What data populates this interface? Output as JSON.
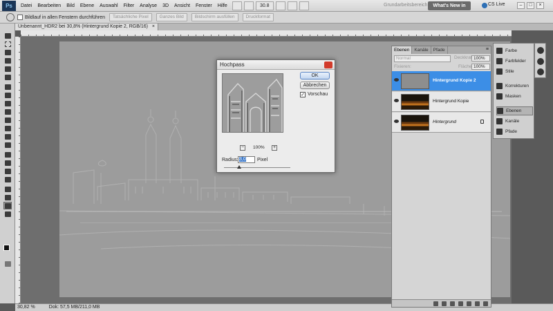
{
  "app": {
    "logo": "Ps"
  },
  "menu": {
    "items": [
      "Datei",
      "Bearbeiten",
      "Bild",
      "Ebene",
      "Auswahl",
      "Filter",
      "Analyse",
      "3D",
      "Ansicht",
      "Fenster",
      "Hilfe"
    ]
  },
  "topbar": {
    "workspace_label": "Grundarbeitsbereich",
    "whats_new": "What's New in CS5",
    "cs_live": "CS Live",
    "zoom_value": "30.8",
    "window_controls": [
      "–",
      "□",
      "×"
    ]
  },
  "options": {
    "resize_windows_label": "Bildlauf in allen Fenstern durchführen",
    "buttons": [
      "Tatsächliche Pixel",
      "Ganzes Bild",
      "Bildschirm ausfüllen",
      "Druckformat"
    ]
  },
  "document": {
    "tab_title": "Unbenannt_HDR2 bei 30,8% (Hintergrund Kopie 2, RGB/16)",
    "close_glyph": "×",
    "status_zoom": "30,82 %",
    "status_doc": "Dok: 57,5 MB/211,0 MB"
  },
  "dialog": {
    "title": "Hochpass",
    "ok_label": "OK",
    "cancel_label": "Abbrechen",
    "preview_label": "Vorschau",
    "preview_checked": true,
    "zoom_minus": "−",
    "zoom_plus": "+",
    "zoom_percent": "100%",
    "radius_label": "Radius:",
    "radius_value": "3,0",
    "radius_unit": "Pixel"
  },
  "layers_panel": {
    "tabs": [
      "Ebenen",
      "Kanäle",
      "Pfade"
    ],
    "menu_glyph": "≡",
    "blend_mode": "Normal",
    "opacity_label": "Deckkraft:",
    "opacity_value": "100%",
    "lock_label": "Fixieren:",
    "fill_label": "Fläche:",
    "fill_value": "100%",
    "layers": [
      {
        "name": "Hintergrund Kopie 2",
        "selected": true,
        "thumb": "gray"
      },
      {
        "name": "Hintergrund Kopie",
        "selected": false,
        "thumb": "night"
      },
      {
        "name": "Hintergrund",
        "selected": false,
        "thumb": "night",
        "locked": true
      }
    ]
  },
  "dock": {
    "items": [
      "Farbe",
      "Farbfelder",
      "Stile",
      "Korrekturen",
      "Masken",
      "Ebenen",
      "Kanäle",
      "Pfade"
    ],
    "selected": "Ebenen"
  },
  "colors": {
    "accent_selected_layer": "#3c8ee6",
    "whats_new_bg": "#6b6b6b",
    "dialog_close": "#d23b2b"
  }
}
